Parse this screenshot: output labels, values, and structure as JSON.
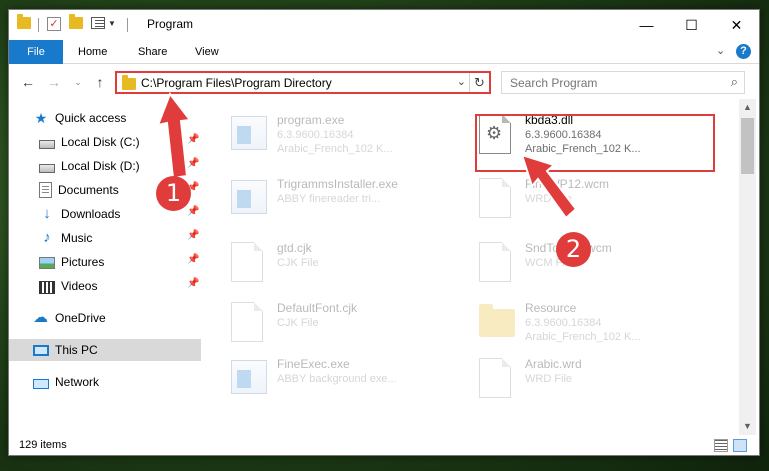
{
  "window": {
    "title": "Program"
  },
  "ribbon": {
    "tabs": [
      "File",
      "Home",
      "Share",
      "View"
    ]
  },
  "address": {
    "path": "C:\\Program Files\\Program Directory"
  },
  "search": {
    "placeholder": "Search Program"
  },
  "sidebar": {
    "items": [
      {
        "label": "Quick access"
      },
      {
        "label": "Local Disk (C:)"
      },
      {
        "label": "Local Disk (D:)"
      },
      {
        "label": "Documents"
      },
      {
        "label": "Downloads"
      },
      {
        "label": "Music"
      },
      {
        "label": "Pictures"
      },
      {
        "label": "Videos"
      },
      {
        "label": "OneDrive"
      },
      {
        "label": "This PC"
      },
      {
        "label": "Network"
      }
    ]
  },
  "files": [
    {
      "name": "program.exe",
      "line1": "6.3.9600.16384",
      "line2": "Arabic_French_102 K..."
    },
    {
      "name": "kbda3.dll",
      "line1": "6.3.9600.16384",
      "line2": "Arabic_French_102 K..."
    },
    {
      "name": "TrigrammsInstaller.exe",
      "line1": "ABBY finereader tri..."
    },
    {
      "name": "FineWP12.wcm",
      "line1": "WRD File"
    },
    {
      "name": "gtd.cjk",
      "line1": "CJK File"
    },
    {
      "name": "SndTorrent.wcm",
      "line1": "WCM File"
    },
    {
      "name": "DefaultFont.cjk",
      "line1": "CJK File"
    },
    {
      "name": "Resource",
      "line1": "6.3.9600.16384",
      "line2": "Arabic_French_102 K..."
    },
    {
      "name": "FineExec.exe",
      "line1": "ABBY background exe..."
    },
    {
      "name": "Arabic.wrd",
      "line1": "WRD File"
    }
  ],
  "status": {
    "item_count": "129 items"
  },
  "annotations": {
    "badge1": "1",
    "badge2": "2"
  },
  "colors": {
    "accent": "#1979ca",
    "highlight": "#e03c3c"
  }
}
